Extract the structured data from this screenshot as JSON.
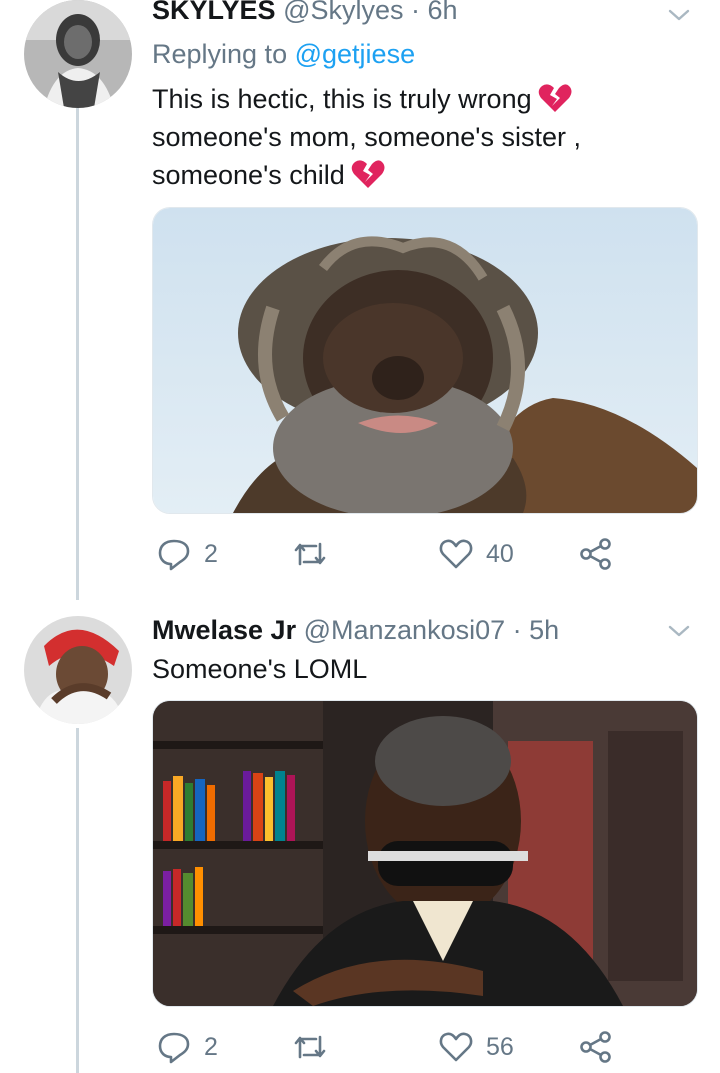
{
  "tweets": [
    {
      "name": "SKYLYES",
      "handle": "@Skylyes",
      "time": "· 6h",
      "replying_prefix": "Replying to",
      "replying_to": "@getjiese",
      "text_lines": [
        "This is hectic,  this is truly wrong",
        "someone's mom, someone's sister ,",
        "someone's child"
      ],
      "reply_count": "2",
      "retweet_count": "",
      "like_count": "40"
    },
    {
      "name": "Mwelase Jr",
      "handle": "@Manzankosi07",
      "time": "· 5h",
      "text_lines": [
        "Someone's LOML"
      ],
      "reply_count": "2",
      "retweet_count": "",
      "like_count": "56"
    }
  ],
  "colors": {
    "accent": "#1da1f2",
    "secondary_text": "#657786",
    "thread_line": "#ccd6dd",
    "emoji_red": "#e0245e"
  },
  "icons": [
    "broken-heart-emoji",
    "reply-icon",
    "retweet-icon",
    "like-icon",
    "share-icon",
    "chevron-down-icon"
  ]
}
